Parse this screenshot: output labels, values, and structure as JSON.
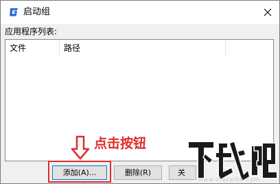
{
  "window": {
    "title": "启动组",
    "icon": "app-logo-icon",
    "close_icon": "close-icon",
    "accent_color": "#2b6cd4"
  },
  "list": {
    "caption": "应用程序列表:",
    "columns": [
      "文件",
      "路径"
    ],
    "rows": []
  },
  "buttons": {
    "add_label": "添加(A)...",
    "delete_label": "删除(R)",
    "close_label": "关"
  },
  "annotation": {
    "text": "点击按钮",
    "color": "#e02a2a",
    "arrow_icon": "arrow-down-icon"
  },
  "watermark": {
    "logo": "下载吧",
    "url": "www.xiazaiba.com"
  }
}
